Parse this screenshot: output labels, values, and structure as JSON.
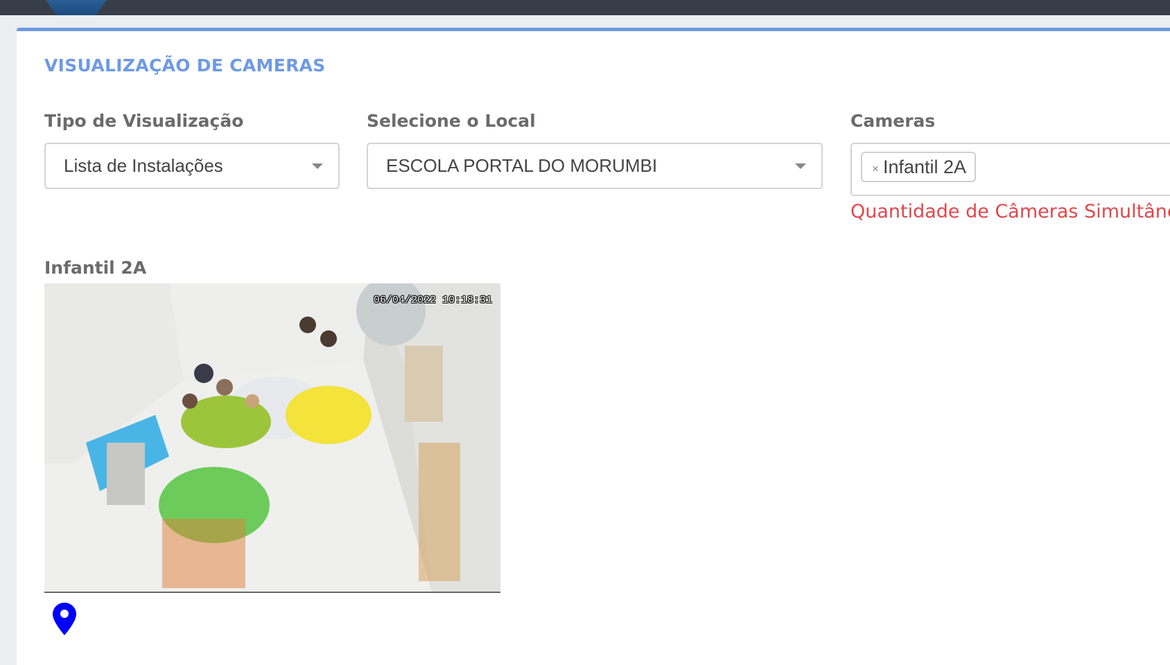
{
  "header": {
    "logo": "logo"
  },
  "page": {
    "title": "VISUALIZAÇÃO DE CAMERAS"
  },
  "filters": {
    "view_type": {
      "label": "Tipo de Visualização",
      "value": "Lista de Instalações"
    },
    "location": {
      "label": "Selecione o Local",
      "value": "ESCOLA PORTAL DO MORUMBI"
    },
    "cameras": {
      "label": "Cameras",
      "selected": [
        {
          "label": "Infantil 2A",
          "remove": "×"
        }
      ],
      "warning": "Quantidade de Câmeras Simultâneas"
    }
  },
  "feeds": [
    {
      "title": "Infantil 2A",
      "timestamp": "06/04/2022 10:18:31",
      "icon": "map-pin-icon",
      "pin_color": "#0000ff"
    }
  ]
}
